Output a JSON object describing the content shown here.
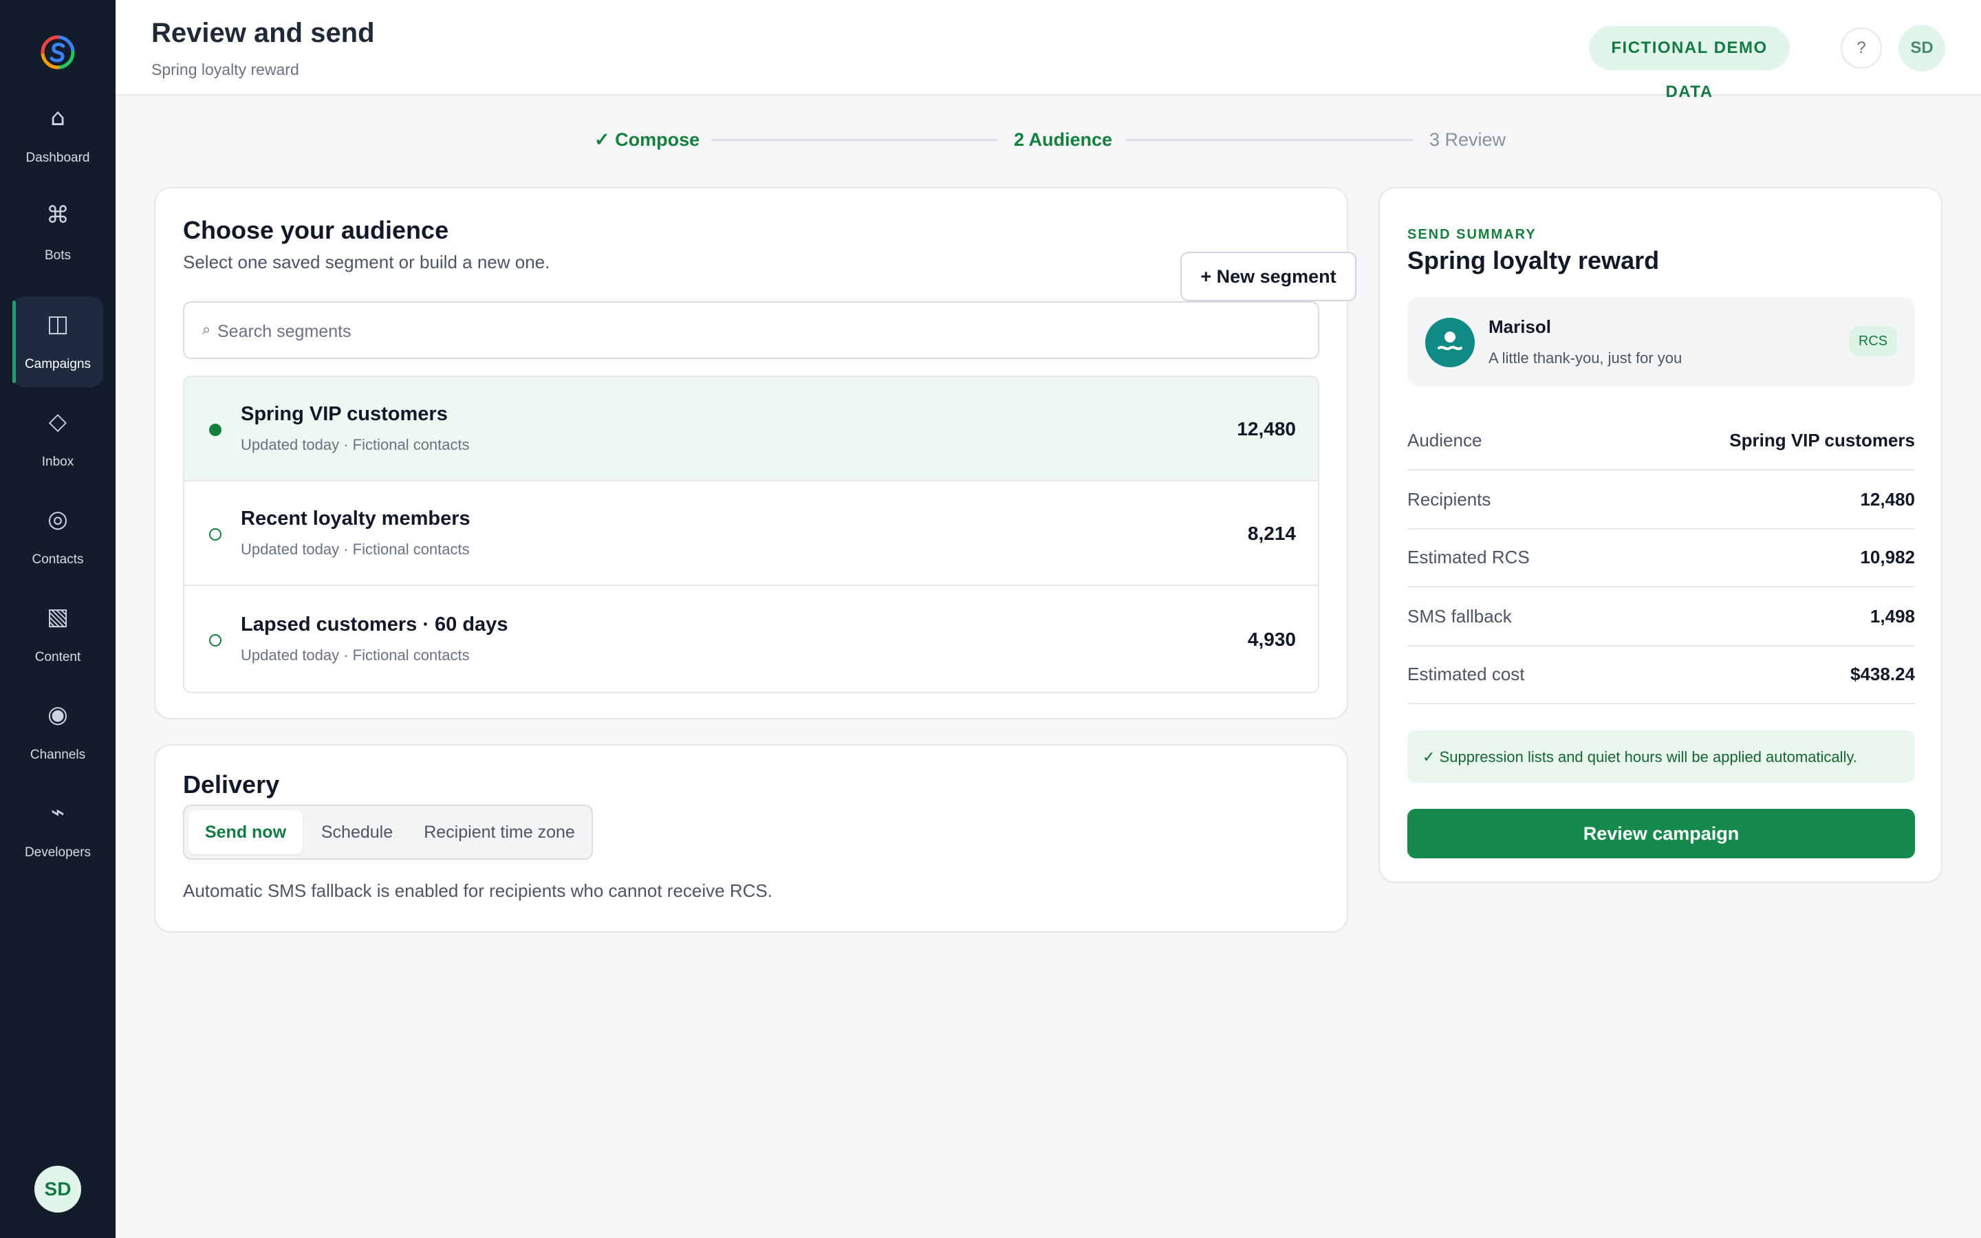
{
  "sidebar": {
    "items": [
      {
        "label": "Dashboard",
        "icon": "home-icon",
        "glyph": "⌂"
      },
      {
        "label": "Bots",
        "icon": "command-icon",
        "glyph": "⌘"
      },
      {
        "label": "Campaigns",
        "icon": "columns-icon",
        "glyph": "◫",
        "active": true
      },
      {
        "label": "Inbox",
        "icon": "diamond-icon",
        "glyph": "◇"
      },
      {
        "label": "Contacts",
        "icon": "circle-icon",
        "glyph": "◎"
      },
      {
        "label": "Content",
        "icon": "hatched-square-icon",
        "glyph": "▧"
      },
      {
        "label": "Channels",
        "icon": "radio-icon",
        "glyph": "◉"
      },
      {
        "label": "Developers",
        "icon": "lightning-icon",
        "glyph": "⌁"
      }
    ],
    "user_initials": "SD"
  },
  "header": {
    "title": "Review and send",
    "subtitle": "Spring loyalty reward",
    "badge": "FICTIONAL DEMO DATA",
    "help": "?",
    "user_initials": "SD"
  },
  "stepper": {
    "steps": [
      {
        "label": "✓ Compose",
        "state": "done"
      },
      {
        "label": "2 Audience",
        "state": "current"
      },
      {
        "label": "3 Review",
        "state": "todo"
      }
    ]
  },
  "audience": {
    "title": "Choose your audience",
    "subtitle": "Select one saved segment or build a new one.",
    "new_segment_label": "+ New segment",
    "search_icon": "⌕",
    "search_placeholder": "Search segments",
    "segments": [
      {
        "name": "Spring VIP customers",
        "meta": "Updated today · Fictional contacts",
        "count": "12,480",
        "selected": true
      },
      {
        "name": "Recent loyalty members",
        "meta": "Updated today · Fictional contacts",
        "count": "8,214",
        "selected": false
      },
      {
        "name": "Lapsed customers · 60 days",
        "meta": "Updated today · Fictional contacts",
        "count": "4,930",
        "selected": false
      }
    ]
  },
  "delivery": {
    "title": "Delivery",
    "tabs": [
      {
        "label": "Send now",
        "active": true
      },
      {
        "label": "Schedule",
        "active": false
      },
      {
        "label": "Recipient time zone",
        "active": false
      }
    ],
    "note": "Automatic SMS fallback is enabled for recipients who cannot receive RCS."
  },
  "summary": {
    "eyebrow": "SEND SUMMARY",
    "title": "Spring loyalty reward",
    "sender_name": "Marisol",
    "sender_message": "A little thank-you, just for you",
    "channel_badge": "RCS",
    "rows": [
      {
        "label": "Audience",
        "value": "Spring VIP customers"
      },
      {
        "label": "Recipients",
        "value": "12,480"
      },
      {
        "label": "Estimated RCS",
        "value": "10,982"
      },
      {
        "label": "SMS fallback",
        "value": "1,498"
      },
      {
        "label": "Estimated cost",
        "value": "$438.24"
      }
    ],
    "notice": "✓ Suppression lists and quiet hours will be applied automatically.",
    "review_button": "Review campaign"
  },
  "colors": {
    "accent": "#168a4c",
    "sidebar_bg": "#131c2b",
    "selected_row_bg": "#eef7f1"
  }
}
